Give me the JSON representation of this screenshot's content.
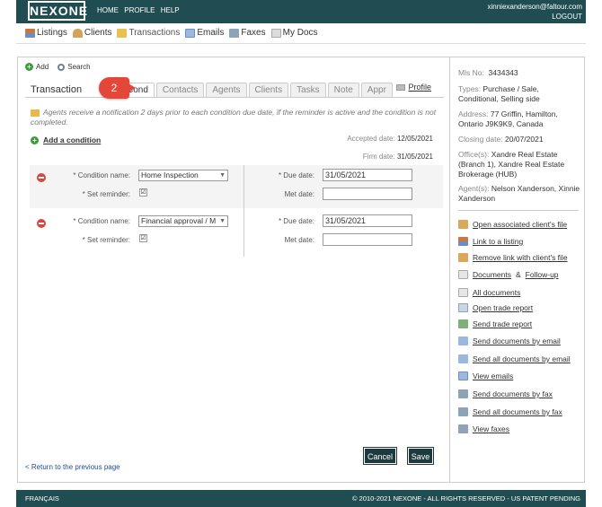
{
  "header": {
    "logo": "NEXONE",
    "nav": [
      "HOME",
      "PROFILE",
      "HELP"
    ],
    "user_email": "xinniexanderson@faltour.com",
    "logout": "LOGOUT"
  },
  "mainnav": [
    {
      "label": "Listings",
      "icon": "house-icon"
    },
    {
      "label": "Clients",
      "icon": "people-icon"
    },
    {
      "label": "Transactions",
      "icon": "folder-icon"
    },
    {
      "label": "Emails",
      "icon": "mail-icon"
    },
    {
      "label": "Faxes",
      "icon": "fax-icon"
    },
    {
      "label": "My Docs",
      "icon": "document-icon"
    }
  ],
  "toolbar": {
    "add": "Add",
    "search": "Search"
  },
  "tabs": {
    "title": "Transaction",
    "items": [
      "Cond",
      "Contacts",
      "Agents",
      "Clients",
      "Tasks",
      "Note",
      "Appr"
    ],
    "active": "Cond",
    "profile": "Profile"
  },
  "callout": "2",
  "notice": "Agents receive a notification 2 days prior to each condition due date, if the reminder is active and the condition is not completed.",
  "add_condition": "Add a condition",
  "dates": {
    "accepted_label": "Accepted date:",
    "accepted_value": "12/05/2021",
    "firm_label": "Firm date:",
    "firm_value": "31/05/2021"
  },
  "labels": {
    "condition_name": "* Condition name:",
    "set_reminder": "* Set reminder:",
    "due_date": "* Due date:",
    "met_date": "Met date:"
  },
  "conditions": [
    {
      "name": "Home Inspection",
      "reminder": "☑",
      "due": "31/05/2021",
      "met": ""
    },
    {
      "name": "Financial approval / M",
      "reminder": "☑",
      "due": "31/05/2021",
      "met": ""
    }
  ],
  "buttons": {
    "cancel": "Cancel",
    "save": "Save"
  },
  "back_link": "< Return to the previous page",
  "side": {
    "mls": {
      "label": "Mls No:",
      "value": "3434343"
    },
    "types": {
      "label": "Types:",
      "value": "Purchase / Sale, Conditional, Selling side"
    },
    "address": {
      "label": "Address:",
      "value": "77 Griffin, Hamilton, Ontario J9K9K9, Canada"
    },
    "closing": {
      "label": "Closing date:",
      "value": "20/07/2021"
    },
    "offices": {
      "label": "Office(s):",
      "value": "Xandre Real Estate (Branch 1), Xandre Real Estate Brokerage (HUB)"
    },
    "agents": {
      "label": "Agent(s):",
      "value": "Nelson Xanderson, Xinnie Xanderson"
    },
    "links": [
      "Open associated client's file",
      "Link to a listing",
      "Remove link with client's file",
      "Documents",
      "All documents",
      "Open trade report",
      "Send trade report",
      "Send documents by email",
      "Send all documents by email",
      "View emails",
      "Send documents by fax",
      "Send all documents by fax",
      "View faxes"
    ],
    "amp": "&",
    "followup": "Follow-up"
  },
  "footer": {
    "lang": "FRANÇAIS",
    "copyright": "© 2010-2021 NEXONE - ALL RIGHTS RESERVED - US PATENT PENDING"
  }
}
